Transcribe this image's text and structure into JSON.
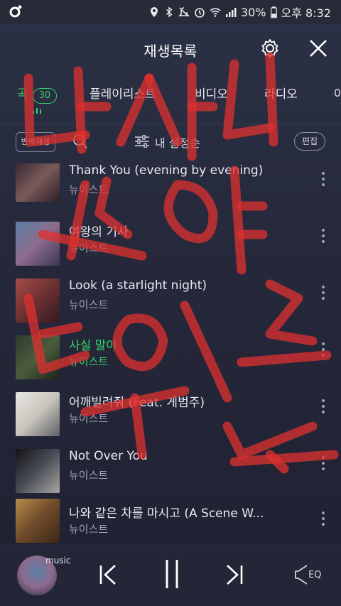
{
  "status_bar": {
    "battery": "30%",
    "clock": "오후 8:32"
  },
  "header": {
    "title": "재생목록"
  },
  "tabs": [
    {
      "label": "곡",
      "count": "30",
      "active": true
    },
    {
      "label": "플레이리스트"
    },
    {
      "label": "비디오"
    },
    {
      "label": "라디오"
    },
    {
      "label": "아"
    }
  ],
  "toolbar": {
    "repeat_label": "반복재생",
    "sort_label": "내 설정순",
    "edit_label": "편집"
  },
  "songs": [
    {
      "title": "Thank You (evening by evening)",
      "artist": "뉴이스트",
      "playing": false
    },
    {
      "title": "여왕의 기사",
      "artist": "뉴이스트",
      "playing": false
    },
    {
      "title": "Look (a starlight night)",
      "artist": "뉴이스트",
      "playing": false
    },
    {
      "title": "사실 말야",
      "artist": "뉴이스트",
      "playing": true
    },
    {
      "title": "어깨빌려줘 (Feat. 게범주)",
      "artist": "뉴이스트",
      "playing": false
    },
    {
      "title": "Not Over You",
      "artist": "뉴이스트",
      "playing": false
    },
    {
      "title": "나와 같은 차를 마시고 (A Scene W...",
      "artist": "뉴이스트",
      "playing": false
    }
  ],
  "player": {
    "badge": "music",
    "eq_label": "EQ"
  },
  "colors": {
    "accent": "#36d36c",
    "overlay_red": "#e0302f"
  }
}
